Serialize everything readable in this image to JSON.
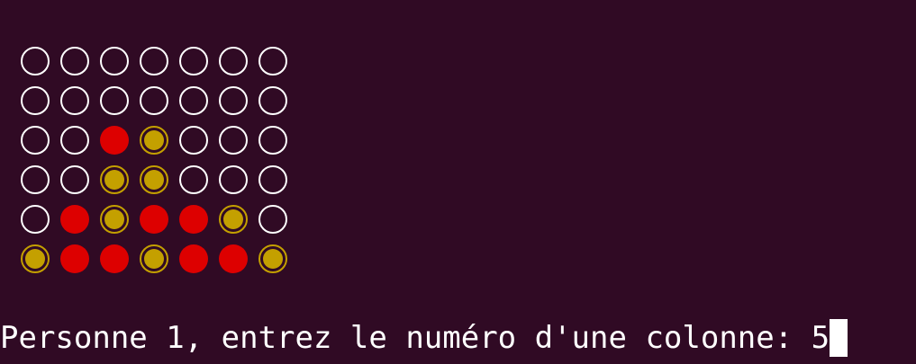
{
  "terminal": {
    "prompt_text": "Personne 1, entrez le numéro d'une colonne: ",
    "input_value": "5"
  },
  "board": {
    "columns": 7,
    "rows": 6,
    "cells": [
      [
        "empty",
        "empty",
        "empty",
        "empty",
        "empty",
        "empty",
        "empty"
      ],
      [
        "empty",
        "empty",
        "empty",
        "empty",
        "empty",
        "empty",
        "empty"
      ],
      [
        "empty",
        "empty",
        "red",
        "yellow",
        "empty",
        "empty",
        "empty"
      ],
      [
        "empty",
        "empty",
        "yellow",
        "yellow",
        "empty",
        "empty",
        "empty"
      ],
      [
        "empty",
        "red",
        "yellow",
        "red",
        "red",
        "yellow",
        "empty"
      ],
      [
        "yellow",
        "red",
        "red",
        "yellow",
        "red",
        "red",
        "yellow"
      ]
    ]
  },
  "colors": {
    "background": "#300a24",
    "text": "#ffffff",
    "empty_outline": "#ffffff",
    "red_piece": "#dd0000",
    "yellow_piece": "#c4a000"
  }
}
